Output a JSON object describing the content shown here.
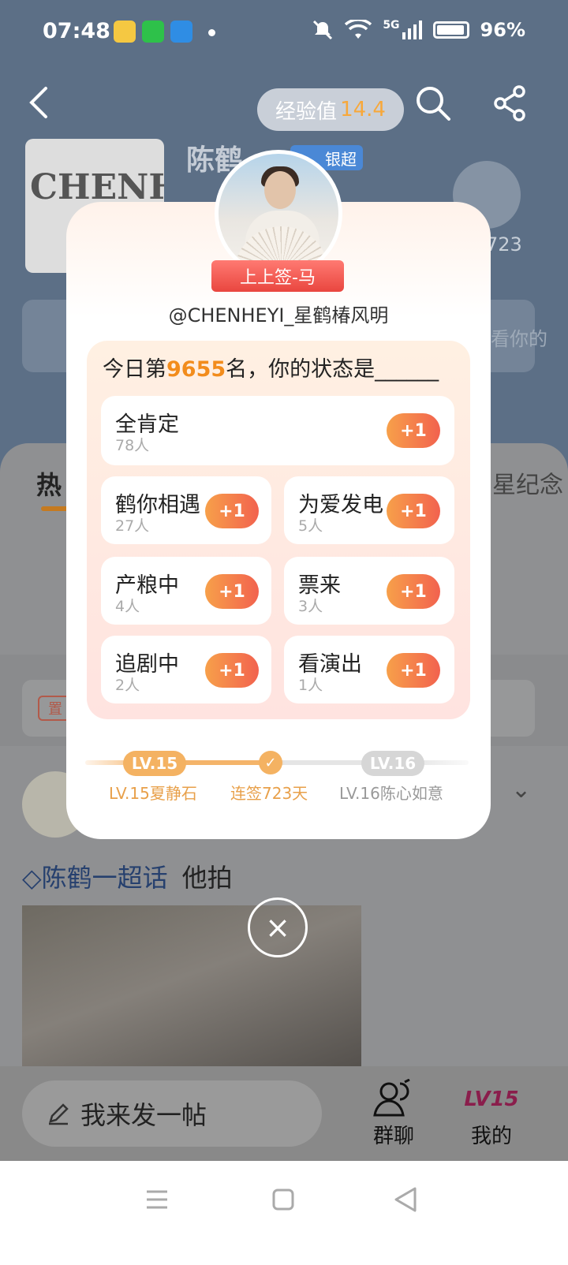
{
  "status_bar": {
    "time": "07:48",
    "network": "5G",
    "battery": "96%",
    "icons": [
      "weibo-app-icon",
      "wechat-app-icon",
      "network-tool-icon",
      "mute-icon",
      "wifi-icon",
      "signal-icon",
      "battery-icon"
    ]
  },
  "header": {
    "exp_label": "经验值",
    "exp_value": "14.4"
  },
  "topic": {
    "cover_text": "CHENHEYI",
    "name": "陈鹤",
    "badge": "银超",
    "days_partial": "723",
    "row_partial": "看你的"
  },
  "tabs": {
    "hot": "热",
    "right": "星纪念"
  },
  "feed": {
    "pin_label": "置",
    "topic_link": "陈鹤一超话",
    "topic_suffix": "他拍"
  },
  "bottom_bar": {
    "compose": "我来发一帖",
    "group_chat": "群聊",
    "mine": "我的",
    "level_mark": "LV15"
  },
  "modal": {
    "ribbon": "上上签-马",
    "handle": "@CHENHEYI_星鹤椿风明",
    "status_prefix": "今日第",
    "rank": "9655",
    "status_suffix": "名，你的状态是______",
    "options": [
      {
        "title": "全肯定",
        "count": "78人",
        "btn": "+1"
      },
      {
        "title": "鹤你相遇",
        "count": "27人",
        "btn": "+1"
      },
      {
        "title": "为爱发电",
        "count": "5人",
        "btn": "+1"
      },
      {
        "title": "产粮中",
        "count": "4人",
        "btn": "+1"
      },
      {
        "title": "票来",
        "count": "3人",
        "btn": "+1"
      },
      {
        "title": "追剧中",
        "count": "2人",
        "btn": "+1"
      },
      {
        "title": "看演出",
        "count": "1人",
        "btn": "+1"
      }
    ],
    "level": {
      "current_pill": "LV.15",
      "next_pill": "LV.16",
      "current_caption": "LV.15夏静石",
      "streak_caption": "连签723天",
      "next_caption": "LV.16陈心如意"
    },
    "close_icon": "×"
  },
  "colors": {
    "accent_orange": "#f28c1c",
    "plus_gradient_start": "#f7a04a",
    "plus_gradient_end": "#f2624e",
    "ribbon_red": "#e9463f"
  }
}
